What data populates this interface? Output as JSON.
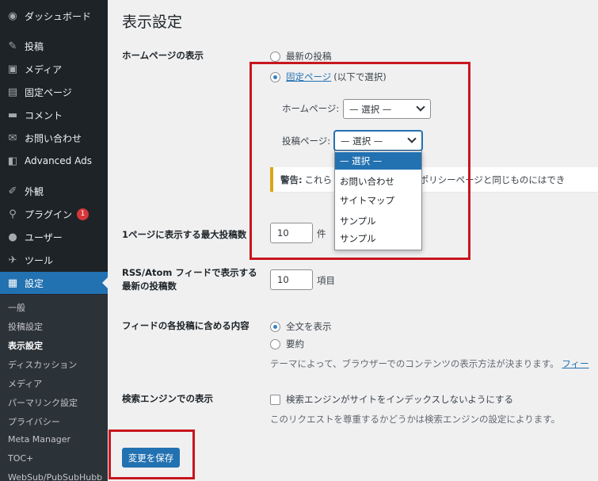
{
  "sidebar": {
    "items": [
      {
        "label": "ダッシュボード",
        "icon": "dashboard-icon"
      },
      {
        "label": "投稿",
        "icon": "pin-icon"
      },
      {
        "label": "メディア",
        "icon": "media-icon"
      },
      {
        "label": "固定ページ",
        "icon": "page-icon"
      },
      {
        "label": "コメント",
        "icon": "comment-icon"
      },
      {
        "label": "お問い合わせ",
        "icon": "mail-icon"
      },
      {
        "label": "Advanced Ads",
        "icon": "ads-icon"
      },
      {
        "label": "外観",
        "icon": "appearance-icon"
      },
      {
        "label": "プラグイン",
        "icon": "plugin-icon",
        "badge": "1"
      },
      {
        "label": "ユーザー",
        "icon": "user-icon"
      },
      {
        "label": "ツール",
        "icon": "wrench-icon"
      },
      {
        "label": "設定",
        "icon": "settings-icon"
      }
    ],
    "submenu": [
      "一般",
      "投稿設定",
      "表示設定",
      "ディスカッション",
      "メディア",
      "パーマリンク設定",
      "プライバシー",
      "Meta Manager",
      "TOC+",
      "WebSub/PubSubHubb"
    ]
  },
  "page": {
    "title": "表示設定",
    "homepage_display": {
      "label": "ホームページの表示",
      "option_latest": "最新の投稿",
      "option_static_link": "固定ページ",
      "option_static_suffix": "(以下で選択)",
      "homepage_label": "ホームページ:",
      "homepage_value": "— 選択 —",
      "postspage_label": "投稿ページ:",
      "postspage_value": "— 選択 —",
      "warning_label": "警告:",
      "warning_text_a": "これら",
      "warning_text_b": "バシーポリシーページと同じものにはでき"
    },
    "dropdown_options": [
      "— 選択 —",
      "お問い合わせ",
      "サイトマップ",
      "サンプル",
      "サンプル"
    ],
    "posts_per_page": {
      "label": "1ページに表示する最大投稿数",
      "value": "10",
      "unit": "件"
    },
    "rss": {
      "label_line1": "RSS/Atom フィードで表示する",
      "label_line2": "最新の投稿数",
      "value": "10",
      "unit": "項目"
    },
    "feed_content": {
      "label": "フィードの各投稿に含める内容",
      "option_full": "全文を表示",
      "option_summary": "要約",
      "desc": "テーマによって、ブラウザーでのコンテンツの表示方法が決まります。",
      "desc_link": "フィー"
    },
    "search_engine": {
      "label": "検索エンジンでの表示",
      "checkbox_label": "検索エンジンがサイトをインデックスしないようにする",
      "desc": "このリクエストを尊重するかどうかは検索エンジンの設定によります。"
    },
    "save_button": "変更を保存"
  },
  "colors": {
    "sidebar_bg": "#1d2327",
    "accent": "#2271b1",
    "highlight_box": "#c8161d",
    "warning_border": "#dba617"
  }
}
